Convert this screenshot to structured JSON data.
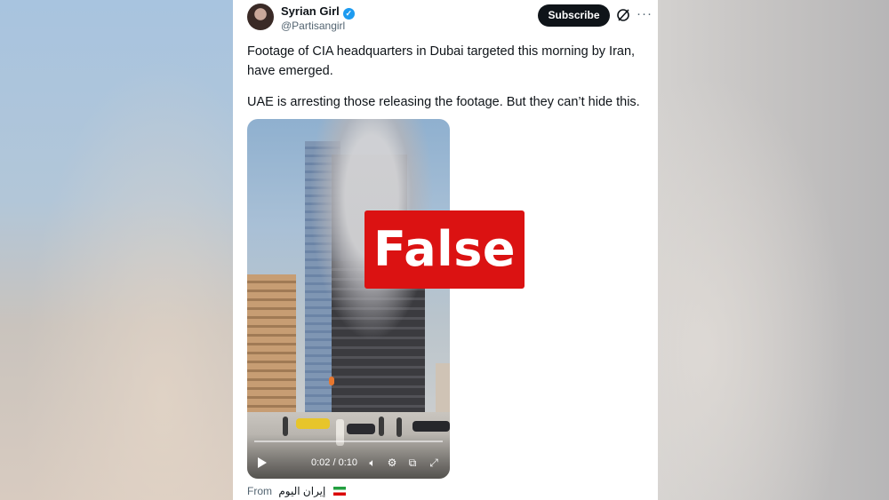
{
  "tweet": {
    "author_name": "Syrian Girl",
    "handle": "@Partisangirl",
    "subscribe_label": "Subscribe",
    "more_label": "···",
    "text_line1": "Footage of CIA headquarters in Dubai targeted this morning by Iran, have emerged.",
    "text_line2": "UAE is arresting those releasing the footage. But they can’t hide this.",
    "verified_color": "#1d9bf0"
  },
  "video": {
    "time": "0:02 / 0:10",
    "progress": 0.2
  },
  "attribution": {
    "from_label": "From",
    "source_name": "إيران اليوم"
  },
  "overlay": {
    "label": "False",
    "color": "#db1212"
  }
}
